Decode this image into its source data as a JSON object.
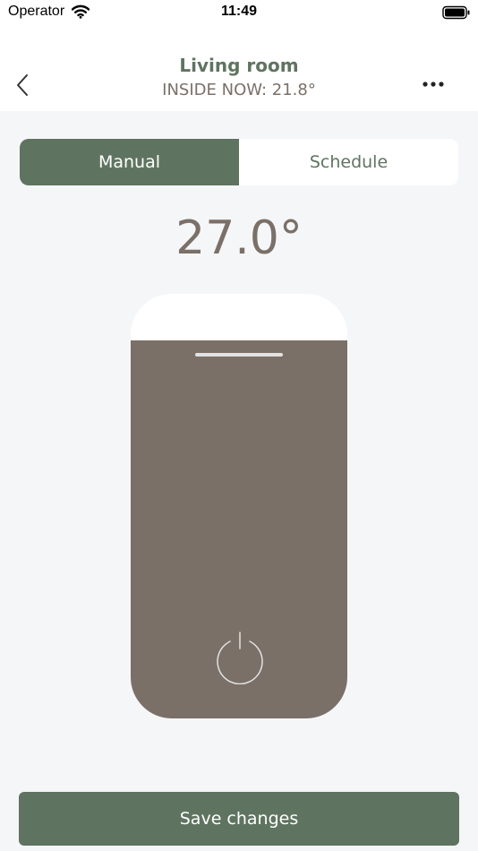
{
  "status_bar": {
    "carrier": "Operator",
    "time": "11:49",
    "wifi_icon": "wifi-icon",
    "battery_icon": "battery-icon"
  },
  "header": {
    "title": "Living room",
    "subtitle": "INSIDE NOW: 21.8°",
    "back_icon": "chevron-left-icon",
    "more_icon": "ellipsis-icon"
  },
  "mode_tabs": {
    "items": [
      {
        "label": "Manual",
        "active": true
      },
      {
        "label": "Schedule",
        "active": false
      }
    ]
  },
  "thermostat": {
    "target_temperature": "27.0°",
    "fill_fraction": 0.89,
    "power_icon": "power-icon"
  },
  "actions": {
    "save_label": "Save changes"
  },
  "colors": {
    "accent": "#5f7460",
    "fill": "#7a7068",
    "background": "#f5f6f8"
  }
}
